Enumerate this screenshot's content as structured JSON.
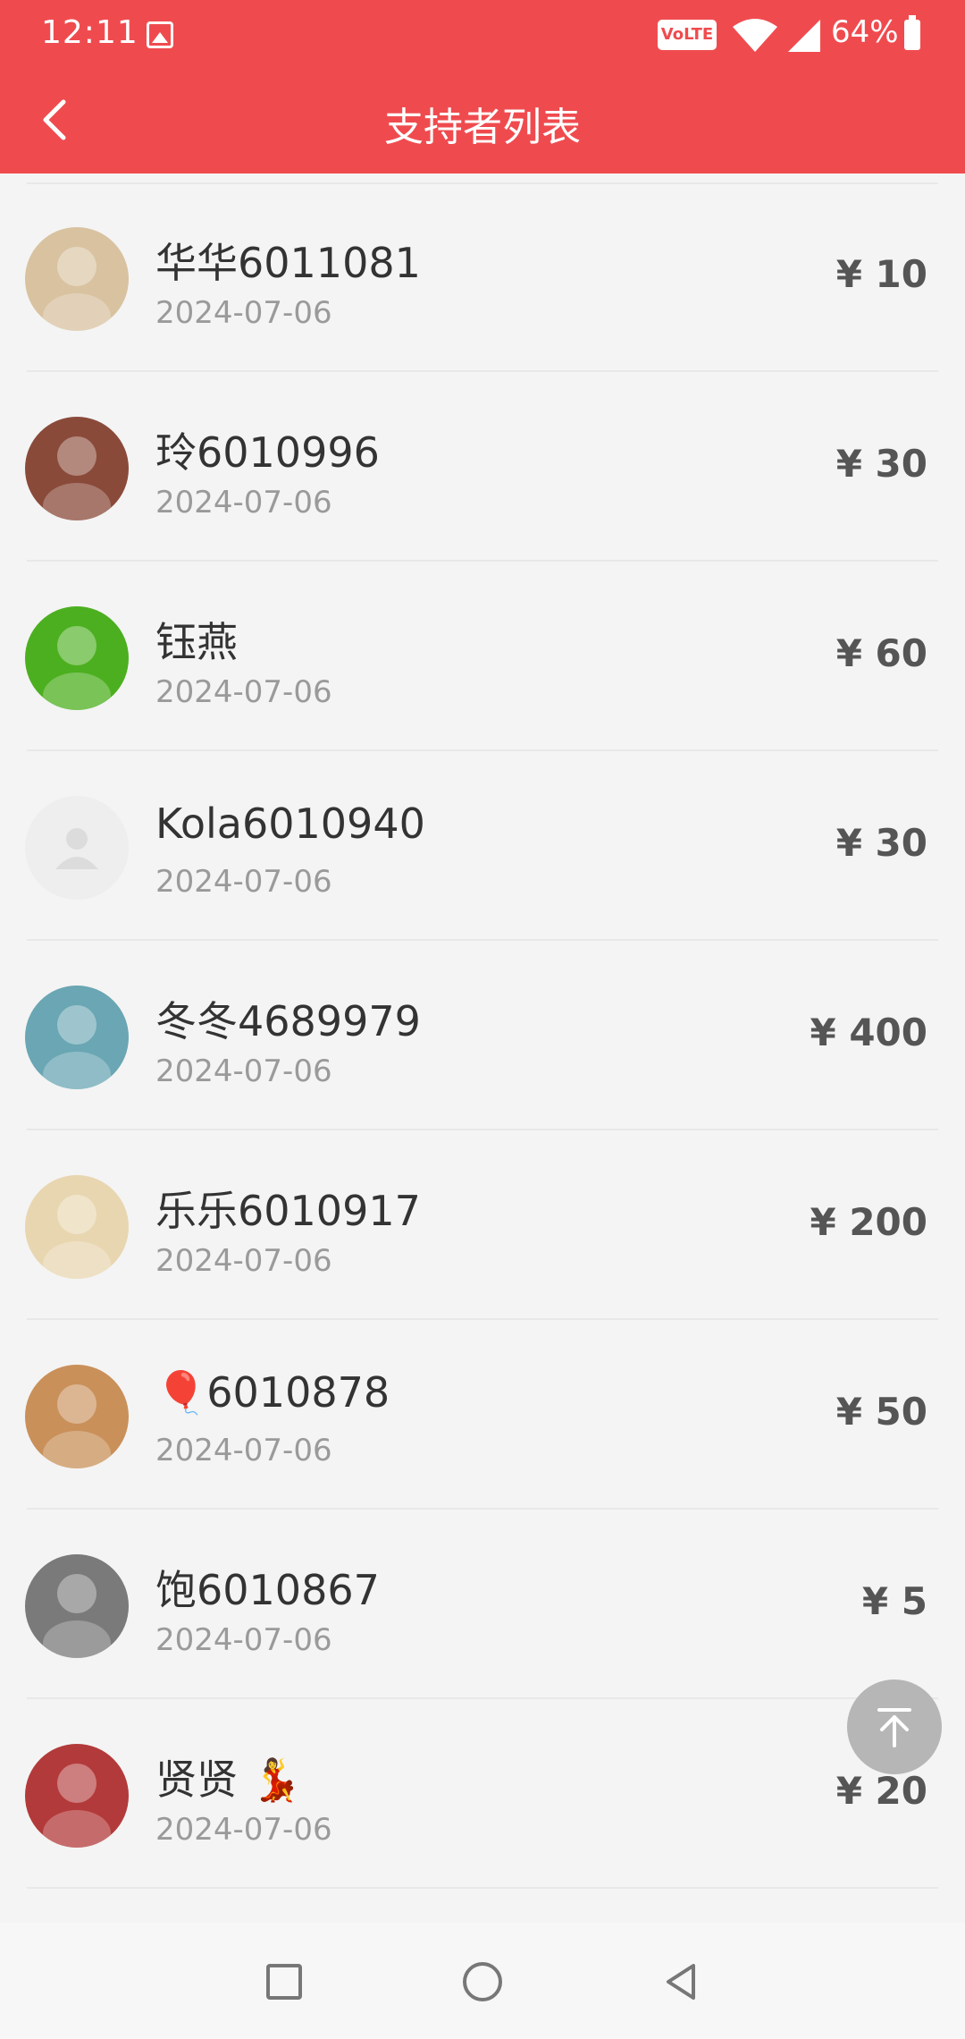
{
  "status_bar": {
    "time": "12:11",
    "volte": "VoLTE",
    "battery": "64%"
  },
  "header": {
    "title": "支持者列表"
  },
  "supporters": [
    {
      "name": "华华6011081",
      "date": "2024-07-06",
      "amount": "¥ 10",
      "avatar": "cat-avatar",
      "avatar_color": "#d9c2a0"
    },
    {
      "name": "玲6010996",
      "date": "2024-07-06",
      "amount": "¥ 30",
      "avatar": "girl-avatar",
      "avatar_color": "#8a4a3a"
    },
    {
      "name": "钰燕",
      "date": "2024-07-06",
      "amount": "¥ 60",
      "avatar": "water-drop-avatar",
      "avatar_color": "#4caf1f"
    },
    {
      "name": "Kola6010940",
      "date": "2024-07-06",
      "amount": "¥ 30",
      "avatar": "default-user-avatar",
      "avatar_color": "#eeeeee"
    },
    {
      "name": "冬冬4689979",
      "date": "2024-07-06",
      "amount": "¥ 400",
      "avatar": "cartoon-girl-avatar",
      "avatar_color": "#6aa6b3"
    },
    {
      "name": "乐乐6010917",
      "date": "2024-07-06",
      "amount": "¥ 200",
      "avatar": "flower-avatar",
      "avatar_color": "#e8d6b0"
    },
    {
      "name": "🎈6010878",
      "date": "2024-07-06",
      "amount": "¥ 50",
      "avatar": "crowned-cat-avatar",
      "avatar_color": "#c9905a"
    },
    {
      "name": "饱6010867",
      "date": "2024-07-06",
      "amount": "¥ 5",
      "avatar": "princess-avatar",
      "avatar_color": "#7a7a7a"
    },
    {
      "name": "贤贤 💃",
      "date": "2024-07-06",
      "amount": "¥ 20",
      "avatar": "woman-photo-avatar",
      "avatar_color": "#b33a3a"
    }
  ],
  "colors": {
    "header_bg": "#ef4b4f",
    "amount": "#555555",
    "date": "#9a9a9a"
  },
  "icons": {
    "back": "chevron-left-icon",
    "back_to_top": "arrow-up-to-line-icon"
  }
}
